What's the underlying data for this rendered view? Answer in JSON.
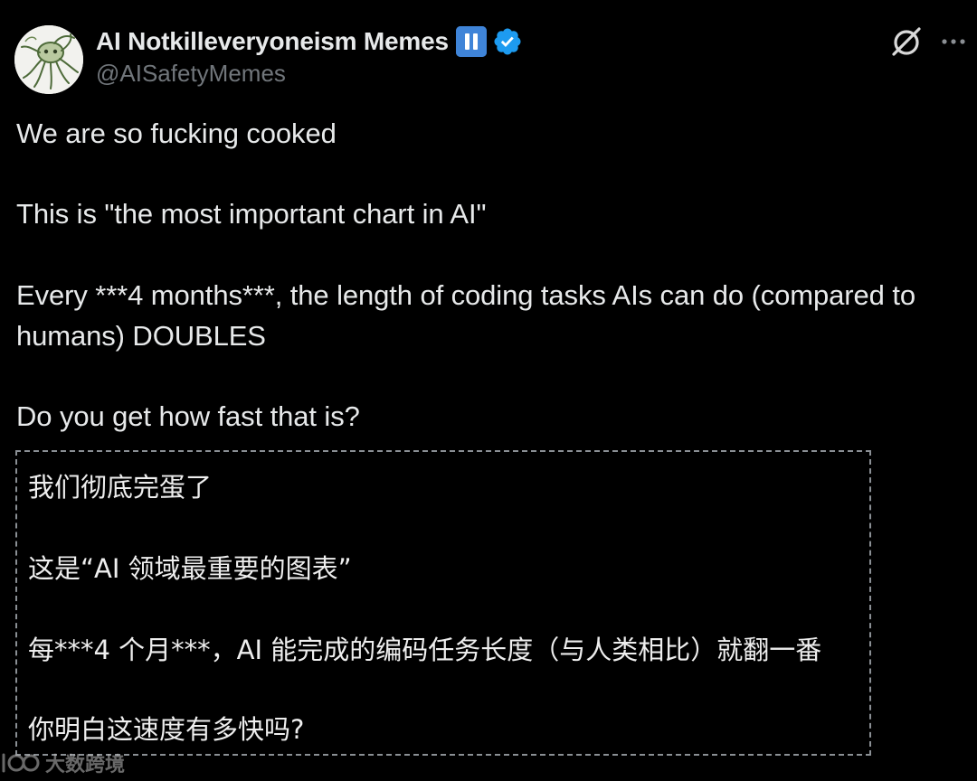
{
  "author": {
    "display_name": "AI Notkilleveryoneism Memes",
    "handle": "@AISafetyMemes",
    "avatar_icon": "octopus-sketch-avatar",
    "badges": [
      "pause-badge-icon",
      "verified-badge-icon"
    ],
    "verified_color": "#1d9bf0"
  },
  "actions": {
    "grok_icon": "grok-icon",
    "more_icon": "more-icon"
  },
  "tweet": {
    "lines": [
      "We are so fucking cooked",
      "This is \"the most important chart in AI\"",
      "Every ***4 months***, the length of coding tasks AIs can do (compared to",
      "humans) DOUBLES",
      "Do you get how fast that is?"
    ]
  },
  "translation": {
    "lines": [
      "我们彻底完蛋了",
      "这是“AI 领域最重要的图表”",
      "每***4 个月***，AI 能完成的编码任务长度（与人类相比）就翻一番",
      "你明白这速度有多快吗?"
    ]
  },
  "watermark": {
    "text": "大数跨境",
    "logo_icon": "watermark-logo-icon"
  },
  "colors": {
    "background": "#000000",
    "text_primary": "#e7e9ea",
    "text_secondary": "#71767b",
    "pause_badge": "#3f84d8",
    "dashed_border": "#8a8f94"
  }
}
